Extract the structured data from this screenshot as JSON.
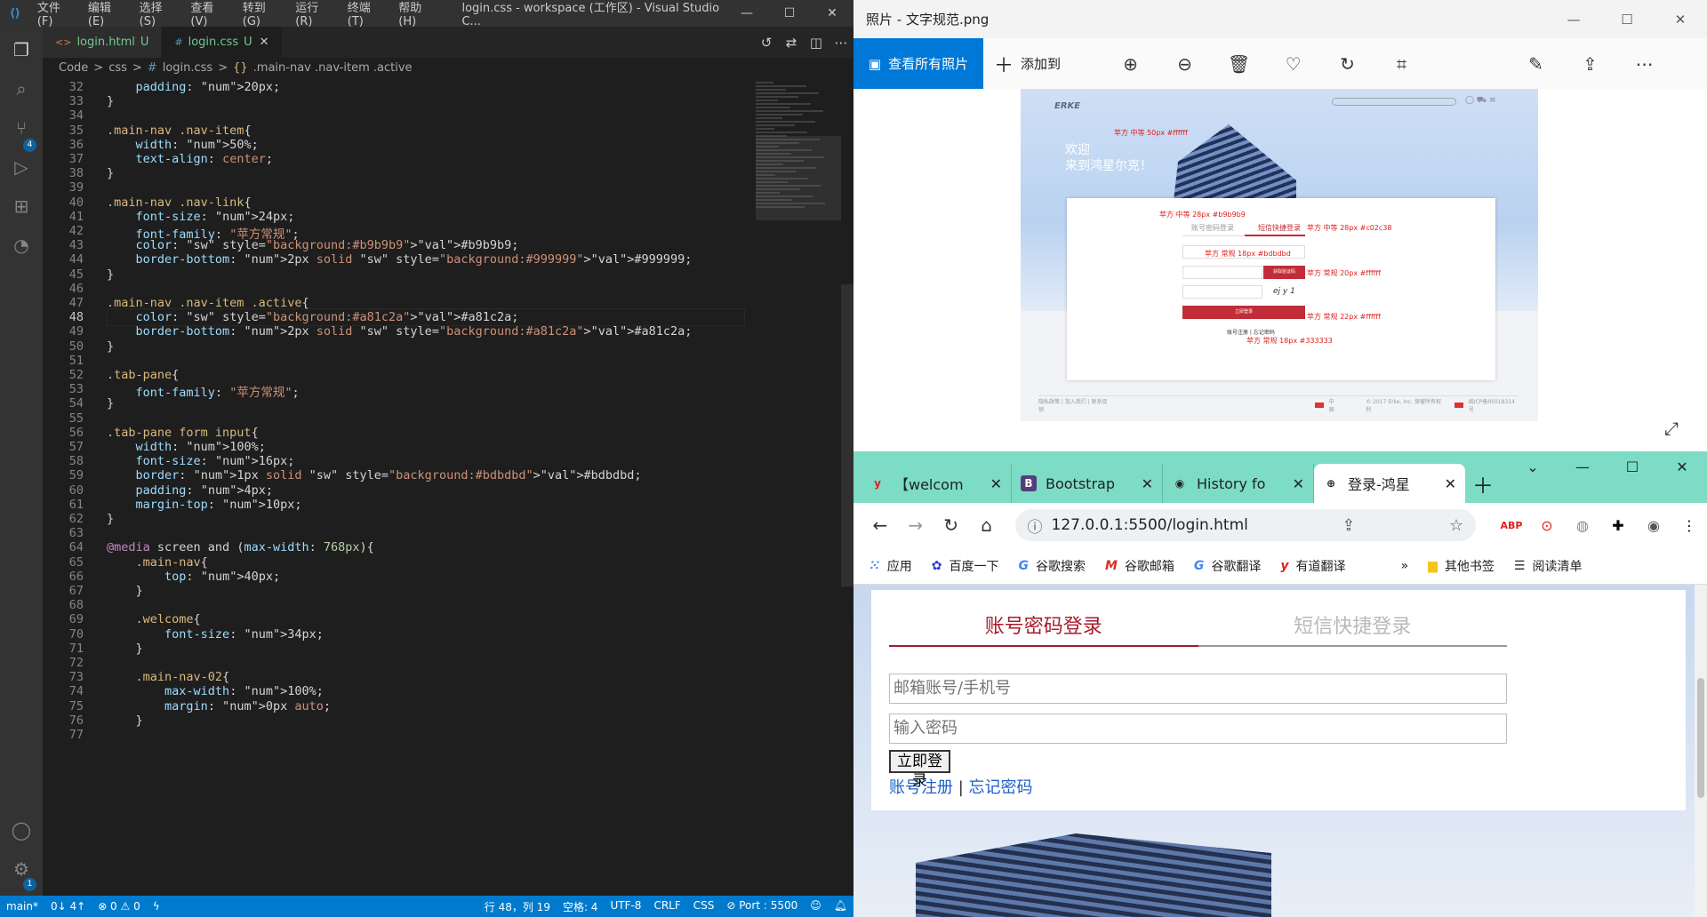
{
  "vscode": {
    "menus": [
      "文件(F)",
      "编辑(E)",
      "选择(S)",
      "查看(V)",
      "转到(G)",
      "运行(R)",
      "终端(T)",
      "帮助(H)"
    ],
    "window_title": "login.css - workspace (工作区) - Visual Studio C...",
    "tabs": [
      {
        "name": "login.html",
        "status": "U",
        "icon": "<>"
      },
      {
        "name": "login.css",
        "status": "U",
        "icon": "#",
        "close": "✕"
      }
    ],
    "breadcrumb": [
      "Code",
      ">",
      "css",
      ">",
      "#",
      "login.css",
      ">",
      "{}",
      ".main-nav .nav-item .active"
    ],
    "badges": {
      "scm": "4",
      "settings": "1"
    },
    "status": {
      "branch": "main*",
      "sync": "0↓ 4↑",
      "problems": "⊗ 0 ⚠ 0",
      "position": "行 48，列 19",
      "spaces": "空格: 4",
      "encoding": "UTF-8",
      "eol": "CRLF",
      "lang": "CSS",
      "port": "⊘ Port : 5500"
    },
    "colors": {
      "accent": "#007acc",
      "swatch_b9": "#b9b9b9",
      "swatch_99": "#999999",
      "swatch_a8": "#a81c2a",
      "swatch_bd": "#bdbdbd"
    }
  },
  "code_lines": [
    {
      "n": "32",
      "t": "    padding: 20px;"
    },
    {
      "n": "33",
      "t": "}"
    },
    {
      "n": "34",
      "t": ""
    },
    {
      "n": "35",
      "t": ".main-nav .nav-item{"
    },
    {
      "n": "36",
      "t": "    width: 50%;"
    },
    {
      "n": "37",
      "t": "    text-align: center;"
    },
    {
      "n": "38",
      "t": "}"
    },
    {
      "n": "39",
      "t": ""
    },
    {
      "n": "40",
      "t": ".main-nav .nav-link{"
    },
    {
      "n": "41",
      "t": "    font-size: 24px;"
    },
    {
      "n": "42",
      "t": "    font-family: \"苹方常规\";"
    },
    {
      "n": "43",
      "t": "    color: #b9b9b9;"
    },
    {
      "n": "44",
      "t": "    border-bottom: 2px solid #999999;"
    },
    {
      "n": "45",
      "t": "}"
    },
    {
      "n": "46",
      "t": ""
    },
    {
      "n": "47",
      "t": ".main-nav .nav-item .active{"
    },
    {
      "n": "48",
      "t": "    color: #a81c2a;"
    },
    {
      "n": "49",
      "t": "    border-bottom: 2px solid #a81c2a;"
    },
    {
      "n": "50",
      "t": "}"
    },
    {
      "n": "51",
      "t": ""
    },
    {
      "n": "52",
      "t": ".tab-pane{"
    },
    {
      "n": "53",
      "t": "    font-family: \"苹方常规\";"
    },
    {
      "n": "54",
      "t": "}"
    },
    {
      "n": "55",
      "t": ""
    },
    {
      "n": "56",
      "t": ".tab-pane form input{"
    },
    {
      "n": "57",
      "t": "    width: 100%;"
    },
    {
      "n": "58",
      "t": "    font-size: 16px;"
    },
    {
      "n": "59",
      "t": "    border: 1px solid #bdbdbd;"
    },
    {
      "n": "60",
      "t": "    padding: 4px;"
    },
    {
      "n": "61",
      "t": "    margin-top: 10px;"
    },
    {
      "n": "62",
      "t": "}"
    },
    {
      "n": "63",
      "t": ""
    },
    {
      "n": "64",
      "t": "@media screen and (max-width: 768px){"
    },
    {
      "n": "65",
      "t": "    .main-nav{"
    },
    {
      "n": "66",
      "t": "        top: 40px;"
    },
    {
      "n": "67",
      "t": "    }"
    },
    {
      "n": "68",
      "t": ""
    },
    {
      "n": "69",
      "t": "    .welcome{"
    },
    {
      "n": "70",
      "t": "        font-size: 34px;"
    },
    {
      "n": "71",
      "t": "    }"
    },
    {
      "n": "72",
      "t": ""
    },
    {
      "n": "73",
      "t": "    .main-nav-02{"
    },
    {
      "n": "74",
      "t": "        max-width: 100%;"
    },
    {
      "n": "75",
      "t": "        margin: 0px auto;"
    },
    {
      "n": "76",
      "t": "    }"
    },
    {
      "n": "77",
      "t": ""
    }
  ],
  "photos": {
    "title": "照片 - 文字规范.png",
    "view_all": "查看所有照片",
    "add_to": "添加到",
    "image": {
      "logo": "ERKE",
      "welcome1": "欢迎",
      "welcome2": "来到鸿星尔克！",
      "ann_title": "苹方 中等 50px #ffffff",
      "ann_tab1": "苹方 中等 28px #b9b9b9",
      "ann_tab2": "苹方 中等 28px #c02c38",
      "tab1": "账号密码登录",
      "tab2": "短信快捷登录",
      "ann_input": "苹方 常规 18px #bdbdbd",
      "code_btn": "获取验证码",
      "ann_codebtn": "苹方 常规 20px #ffffff",
      "captcha": "ej y 1",
      "login_btn": "立即登录",
      "ann_login": "苹方 常规 22px #ffffff",
      "links": "账号注册 | 忘记密码",
      "ann_links": "苹方 常规 18px #333333",
      "foot_links": "隐私政策 | 加入我们 | 联系促销",
      "foot_cn": "中国",
      "foot_copy": "© 2017 Erke, Inc. 保留所有权利",
      "foot_icp": "闽ICP备05018314号"
    }
  },
  "chrome": {
    "tabs": [
      {
        "title": "【welcom",
        "fav": "y"
      },
      {
        "title": "Bootstrap",
        "fav": "B"
      },
      {
        "title": "History fo",
        "fav": "◉"
      },
      {
        "title": "登录-鸿星",
        "fav": "⊕"
      }
    ],
    "url": "127.0.0.1:5500/login.html",
    "bookmarks": [
      "应用",
      "百度一下",
      "谷歌搜索",
      "谷歌邮箱",
      "谷歌翻译",
      "有道翻译"
    ],
    "bookmarks_more": "»",
    "other_bm": "其他书签",
    "reading_list": "阅读清单",
    "page": {
      "tab_active": "账号密码登录",
      "tab_other": "短信快捷登录",
      "ph_account": "邮箱账号/手机号",
      "ph_password": "输入密码",
      "login": "立即登录",
      "register": "账号注册",
      "sep": "|",
      "forgot": "忘记密码"
    }
  }
}
